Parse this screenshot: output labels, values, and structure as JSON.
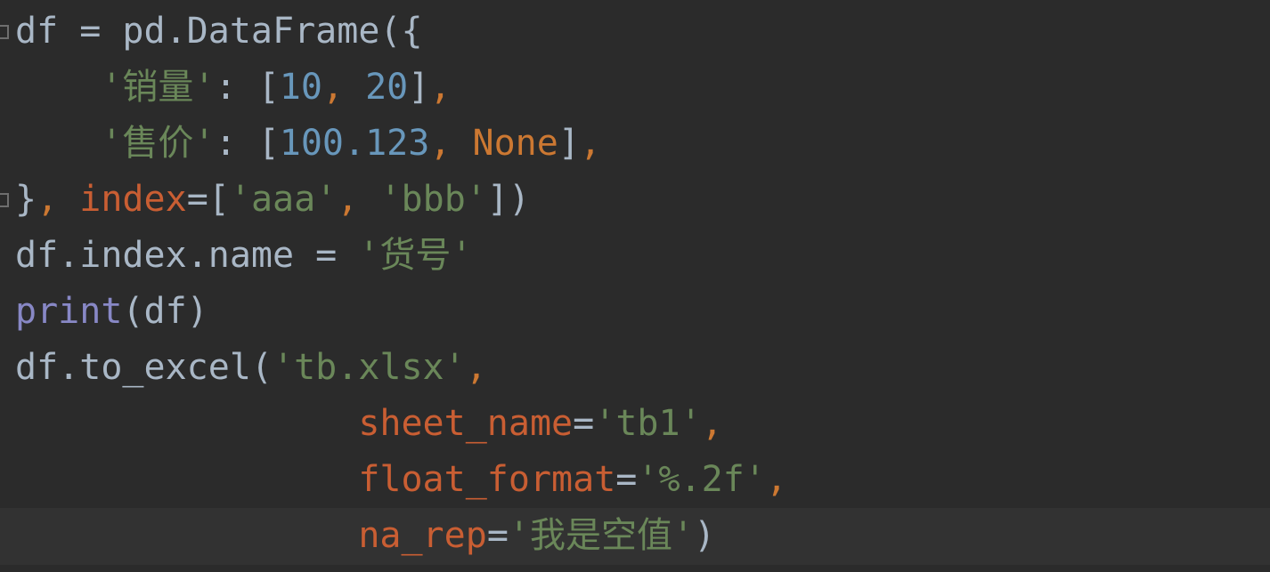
{
  "colors": {
    "background": "#2b2b2b",
    "current_line": "#323232",
    "default": "#a9b7c6",
    "string": "#6a8759",
    "number": "#6897bb",
    "keyword": "#cc7832",
    "param": "#c95e33",
    "builtin": "#8888c6"
  },
  "code_lines": [
    {
      "fold": "start",
      "tokens": [
        {
          "t": "df = pd.DataFrame({",
          "k": "default"
        }
      ]
    },
    {
      "tokens": [
        {
          "t": "    ",
          "k": "default"
        },
        {
          "t": "'销量'",
          "k": "string"
        },
        {
          "t": ": [",
          "k": "default"
        },
        {
          "t": "10",
          "k": "number"
        },
        {
          "t": ", ",
          "k": "punct"
        },
        {
          "t": "20",
          "k": "number"
        },
        {
          "t": "]",
          "k": "default"
        },
        {
          "t": ",",
          "k": "punct"
        }
      ]
    },
    {
      "tokens": [
        {
          "t": "    ",
          "k": "default"
        },
        {
          "t": "'售价'",
          "k": "string"
        },
        {
          "t": ": [",
          "k": "default"
        },
        {
          "t": "100.123",
          "k": "number"
        },
        {
          "t": ", ",
          "k": "punct"
        },
        {
          "t": "None",
          "k": "keyword"
        },
        {
          "t": "]",
          "k": "default"
        },
        {
          "t": ",",
          "k": "punct"
        }
      ]
    },
    {
      "fold": "end",
      "tokens": [
        {
          "t": "}",
          "k": "default"
        },
        {
          "t": ", ",
          "k": "punct"
        },
        {
          "t": "index",
          "k": "param"
        },
        {
          "t": "=[",
          "k": "default"
        },
        {
          "t": "'aaa'",
          "k": "string"
        },
        {
          "t": ", ",
          "k": "punct"
        },
        {
          "t": "'bbb'",
          "k": "string"
        },
        {
          "t": "])",
          "k": "default"
        }
      ]
    },
    {
      "tokens": [
        {
          "t": "df.index.name = ",
          "k": "default"
        },
        {
          "t": "'货号'",
          "k": "string"
        }
      ]
    },
    {
      "tokens": [
        {
          "t": "print",
          "k": "builtin"
        },
        {
          "t": "(df)",
          "k": "default"
        }
      ]
    },
    {
      "tokens": [
        {
          "t": "df.to_excel(",
          "k": "default"
        },
        {
          "t": "'tb.xlsx'",
          "k": "string"
        },
        {
          "t": ",",
          "k": "punct"
        }
      ]
    },
    {
      "tokens": [
        {
          "t": "                ",
          "k": "default"
        },
        {
          "t": "sheet_name",
          "k": "param"
        },
        {
          "t": "=",
          "k": "default"
        },
        {
          "t": "'tb1'",
          "k": "string"
        },
        {
          "t": ",",
          "k": "punct"
        }
      ]
    },
    {
      "tokens": [
        {
          "t": "                ",
          "k": "default"
        },
        {
          "t": "float_format",
          "k": "param"
        },
        {
          "t": "=",
          "k": "default"
        },
        {
          "t": "'%.2f'",
          "k": "string"
        },
        {
          "t": ",",
          "k": "punct"
        }
      ]
    },
    {
      "current": true,
      "tokens": [
        {
          "t": "                ",
          "k": "default"
        },
        {
          "t": "na_rep",
          "k": "param"
        },
        {
          "t": "=",
          "k": "default"
        },
        {
          "t": "'我是空值'",
          "k": "string"
        },
        {
          "t": ")",
          "k": "default"
        }
      ]
    }
  ]
}
